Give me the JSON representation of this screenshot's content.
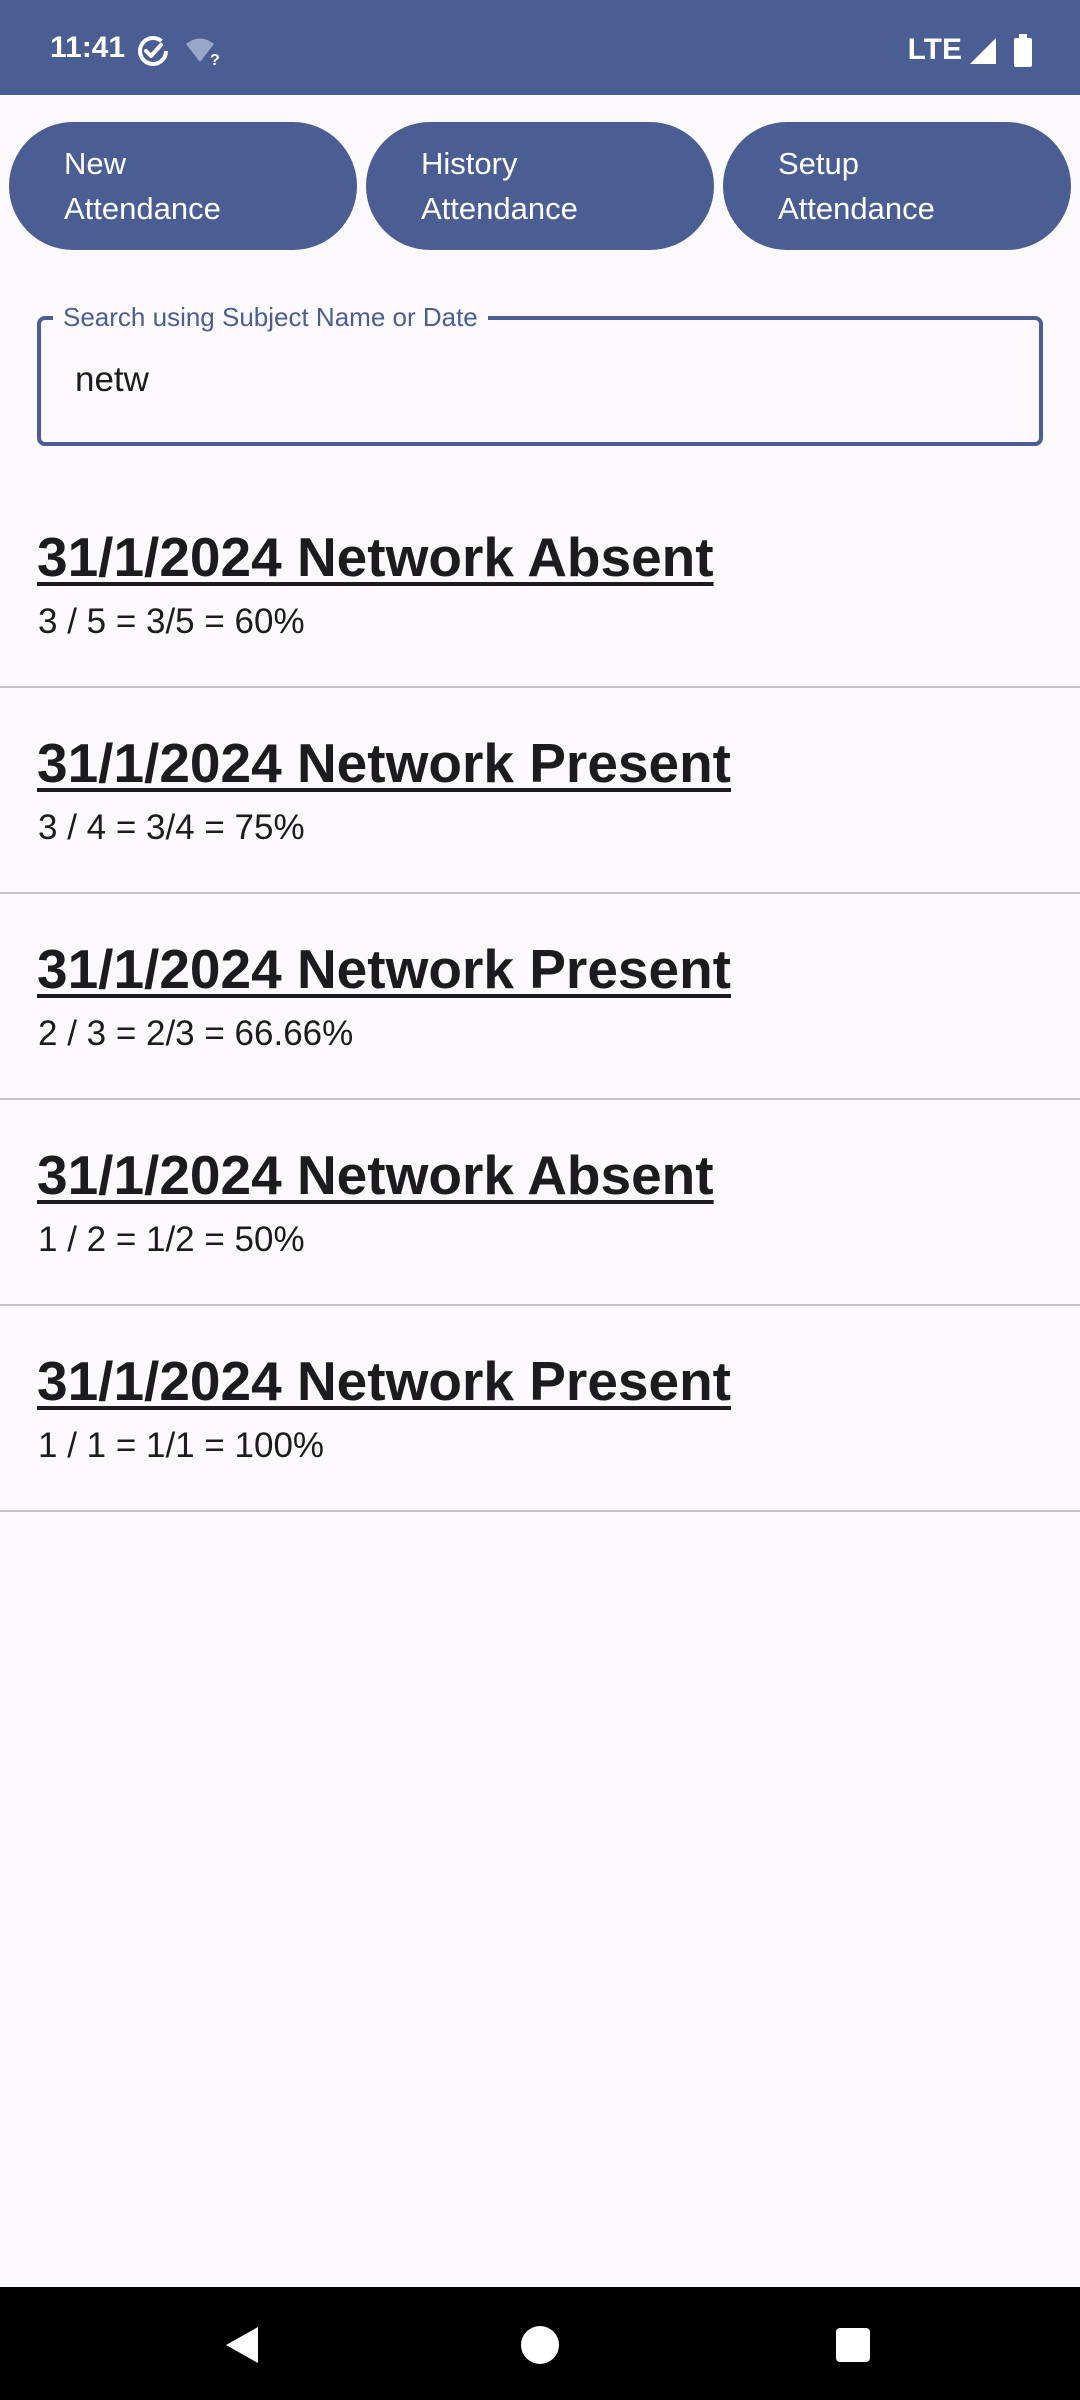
{
  "status_bar": {
    "time": "11:41",
    "network": "LTE",
    "icons": [
      "check-circle-icon",
      "wifi-unknown-icon",
      "signal-icon",
      "battery-icon"
    ]
  },
  "tabs": [
    {
      "line1": "New",
      "line2": "Attendance"
    },
    {
      "line1": "History",
      "line2": "Attendance"
    },
    {
      "line1": "Setup",
      "line2": "Attendance"
    }
  ],
  "search": {
    "label": "Search using Subject Name or Date",
    "value": "netw"
  },
  "records": [
    {
      "title": "31/1/2024 Network Absent",
      "detail": "3 / 5 = 3/5 = 60%"
    },
    {
      "title": "31/1/2024 Network Present",
      "detail": "3 / 4 = 3/4 = 75%"
    },
    {
      "title": "31/1/2024 Network Present",
      "detail": "2 / 3 = 2/3 = 66.66%"
    },
    {
      "title": "31/1/2024 Network Absent",
      "detail": "1 / 2 = 1/2 = 50%"
    },
    {
      "title": "31/1/2024 Network Present",
      "detail": "1 / 1 = 1/1 = 100%"
    }
  ],
  "nav": {
    "icons": [
      "back-icon",
      "home-icon",
      "recents-icon"
    ]
  },
  "colors": {
    "primary": "#4B5E93",
    "background": "#FCF9FD",
    "text": "#1C1B1F",
    "divider": "#C4C4C6"
  }
}
